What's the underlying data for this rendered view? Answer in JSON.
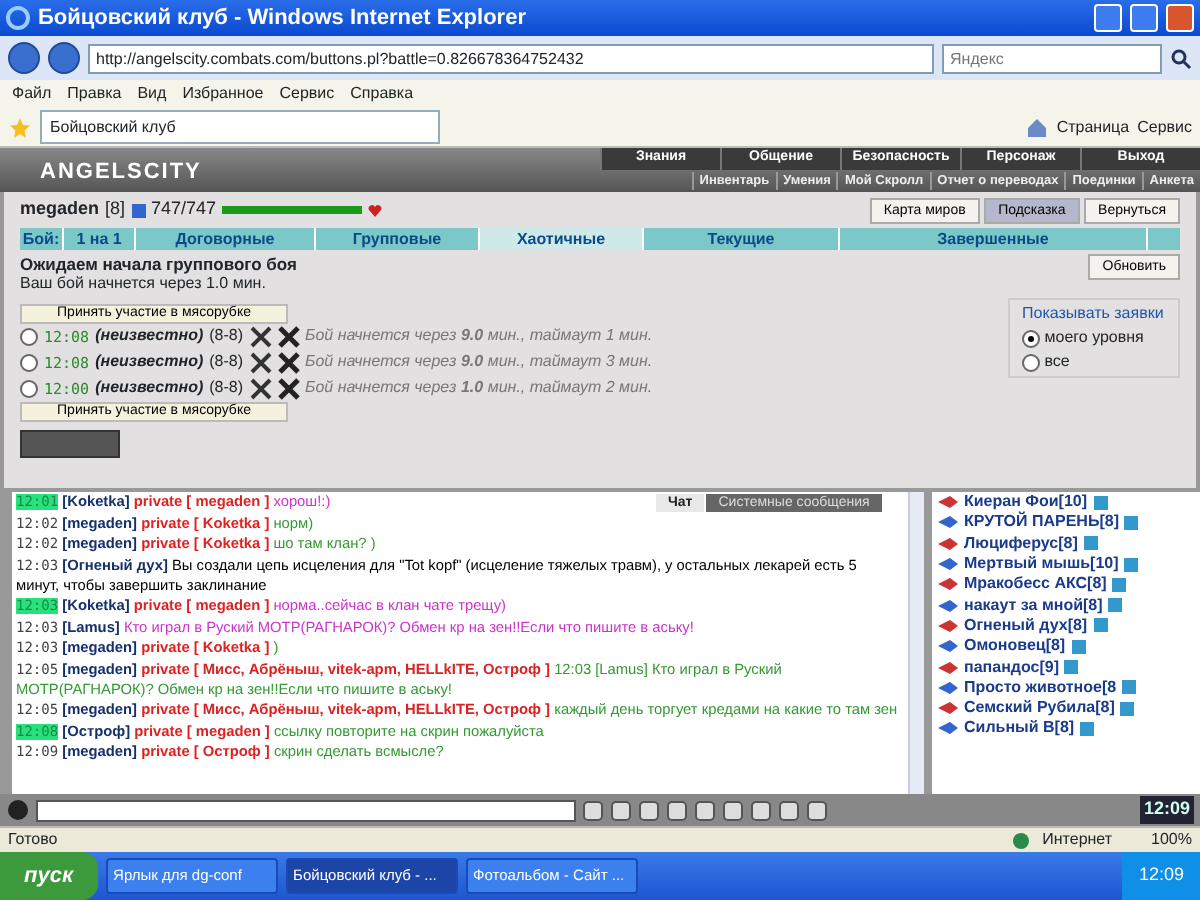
{
  "window": {
    "title": "Бойцовский клуб - Windows Internet Explorer"
  },
  "address_bar": {
    "url": "http://angelscity.combats.com/buttons.pl?battle=0.826678364752432",
    "search_placeholder": "Яндекс"
  },
  "menu": [
    "Файл",
    "Правка",
    "Вид",
    "Избранное",
    "Сервис",
    "Справка"
  ],
  "browser_tab": {
    "title": "Бойцовский клуб"
  },
  "toolbar": [
    "Страница",
    "Сервис"
  ],
  "game_logo": "ANGELSCITY",
  "game_nav": {
    "main": [
      "Знания",
      "Общение",
      "Безопасность",
      "Персонаж",
      "Выход"
    ],
    "sub": [
      "Инвентарь",
      "Умения",
      "Мой Скролл",
      "Отчет о переводах",
      "Поединки",
      "Анкета"
    ]
  },
  "player": {
    "name": "megaden",
    "level": "[8]",
    "hp": "747/747",
    "hp_bar": {
      "level": 1.0
    }
  },
  "top_buttons": [
    {
      "label": "Карта миров",
      "selected": false
    },
    {
      "label": "Подсказка",
      "selected": true
    },
    {
      "label": "Вернуться",
      "selected": false
    }
  ],
  "battle_tabs": {
    "label": "Бой:",
    "tabs": [
      {
        "label": "1 на 1",
        "selected": false
      },
      {
        "label": "Договорные",
        "selected": false
      },
      {
        "label": "Групповые",
        "selected": false
      },
      {
        "label": "Хаотичные",
        "selected": true
      },
      {
        "label": "Текущие",
        "selected": false
      },
      {
        "label": "Завершенные",
        "selected": false
      }
    ]
  },
  "status": {
    "heading": "Ожидаем начала группового боя",
    "text": "Ваш бой начнется через 1.0 мин.",
    "refresh_button": "Обновить"
  },
  "filter": {
    "title": "Показывать заявки",
    "options": [
      {
        "label": "моего уровня",
        "selected": true
      },
      {
        "label": "все",
        "selected": false
      }
    ]
  },
  "join_button_top": "Принять участие в мясорубке",
  "battles": [
    {
      "selected": false,
      "time": "12:08",
      "creator": "(неизвестно)",
      "levels": "(8-8)",
      "info": "Бой начнется через **9.0** мин., таймаут 1 мин."
    },
    {
      "selected": false,
      "time": "12:08",
      "creator": "(неизвестно)",
      "levels": "(8-8)",
      "info": "Бой начнется через **9.0** мин., таймаут 3 мин."
    },
    {
      "selected": false,
      "time": "12:00",
      "creator": "(неизвестно)",
      "levels": "(8-8)",
      "info": "Бой начнется через **1.0** мин., таймаут 2 мин."
    }
  ],
  "join_button_bottom": "Принять участие в мясорубке",
  "chat_tabs": [
    {
      "label": "Чат",
      "selected": true
    },
    {
      "label": "Системные сообщения",
      "selected": false
    }
  ],
  "chat": [
    {
      "time": "12:01",
      "highlighted": true,
      "sender": "[Koketka]",
      "to": "private [ megaden ]",
      "text": "хорош!:)",
      "color": "#cc33cc"
    },
    {
      "time": "12:02",
      "highlighted": false,
      "sender": "[megaden]",
      "to": "private [ Koketka ]",
      "text": "норм)",
      "color": "#339933"
    },
    {
      "time": "12:02",
      "highlighted": false,
      "sender": "[megaden]",
      "to": "private [ Koketka ]",
      "text": "шо там клан? )",
      "color": "#339933"
    },
    {
      "time": "12:03",
      "highlighted": false,
      "sender": "[Огненый дух]",
      "text": "Вы создали цепь исцеления для \"Tot kopf\" (исцеление тяжелых травм), у остальных лекарей есть 5 минут, чтобы завершить заклинание",
      "color": "#000000"
    },
    {
      "time": "12:03",
      "highlighted": true,
      "sender": "[Koketka]",
      "to": "private [ megaden ]",
      "text": "норма..сейчас в клан чате трещу)",
      "color": "#cc33cc"
    },
    {
      "time": "12:03",
      "highlighted": false,
      "sender": "[Lamus]",
      "text": "Кто играл в Руский МОТР(РАГНАРОК)? Обмен кр на зен!!Если что пишите в аську!",
      "color": "#cc33cc"
    },
    {
      "time": "12:03",
      "highlighted": false,
      "sender": "[megaden]",
      "to": "private [ Koketka ]",
      "text": ")",
      "color": "#339933"
    },
    {
      "time": "12:05",
      "highlighted": false,
      "sender": "[megaden]",
      "to": "private [ Мисс, Абрёныш, vitek-apm, HELLkITE, Остроф ]",
      "text": "12:03 [Lamus] Кто играл в Руский МОТР(РАГНАРОК)? Обмен кр на зен!!Если что пишите в аську!",
      "color": "#339933"
    },
    {
      "time": "12:05",
      "highlighted": false,
      "sender": "[megaden]",
      "to": "private [ Мисс, Абрёныш, vitek-apm, HELLkITE, Остроф ]",
      "text": "каждый день торгует кредами на какие то там зен",
      "color": "#339933"
    },
    {
      "time": "12:08",
      "highlighted": true,
      "sender": "[Остроф]",
      "to": "private [ megaden ]",
      "text": "ссылку повторите на скрин пожалуйста",
      "color": "#339933"
    },
    {
      "time": "12:09",
      "highlighted": false,
      "sender": "[megaden]",
      "to": "private [ Остроф ]",
      "text": "скрин сделать всмысле?",
      "color": "#339933"
    }
  ],
  "online": [
    {
      "name": "Киеран Фои",
      "level": "[10]"
    },
    {
      "name": "КРУТОЙ ПАРЕНЬ",
      "level": "[8]"
    },
    {
      "name": "Люциферус",
      "level": "[8]"
    },
    {
      "name": "Мертвый мышь",
      "level": "[10]"
    },
    {
      "name": "Мракобесс АКС",
      "level": "[8]"
    },
    {
      "name": "накаут за мной",
      "level": "[8]"
    },
    {
      "name": "Огненый дух",
      "level": "[8]"
    },
    {
      "name": "Омоновец",
      "level": "[8]"
    },
    {
      "name": "папандос",
      "level": "[9]"
    },
    {
      "name": "Просто животное",
      "level": "[8"
    },
    {
      "name": "Семский Рубила",
      "level": "[8]"
    },
    {
      "name": "Сильный В",
      "level": "[8]"
    }
  ],
  "game_clock": "12:09",
  "status_bar": {
    "text": "Готово",
    "zone": "Интернет",
    "zoom": "100%"
  },
  "taskbar": {
    "start": "пуск",
    "items": [
      {
        "label": "Ярлык для dg-conf",
        "selected": false
      },
      {
        "label": "Бойцовский клуб - ...",
        "selected": true
      },
      {
        "label": "Фотоальбом - Сайт ...",
        "selected": false
      }
    ],
    "clock": "12:09"
  }
}
